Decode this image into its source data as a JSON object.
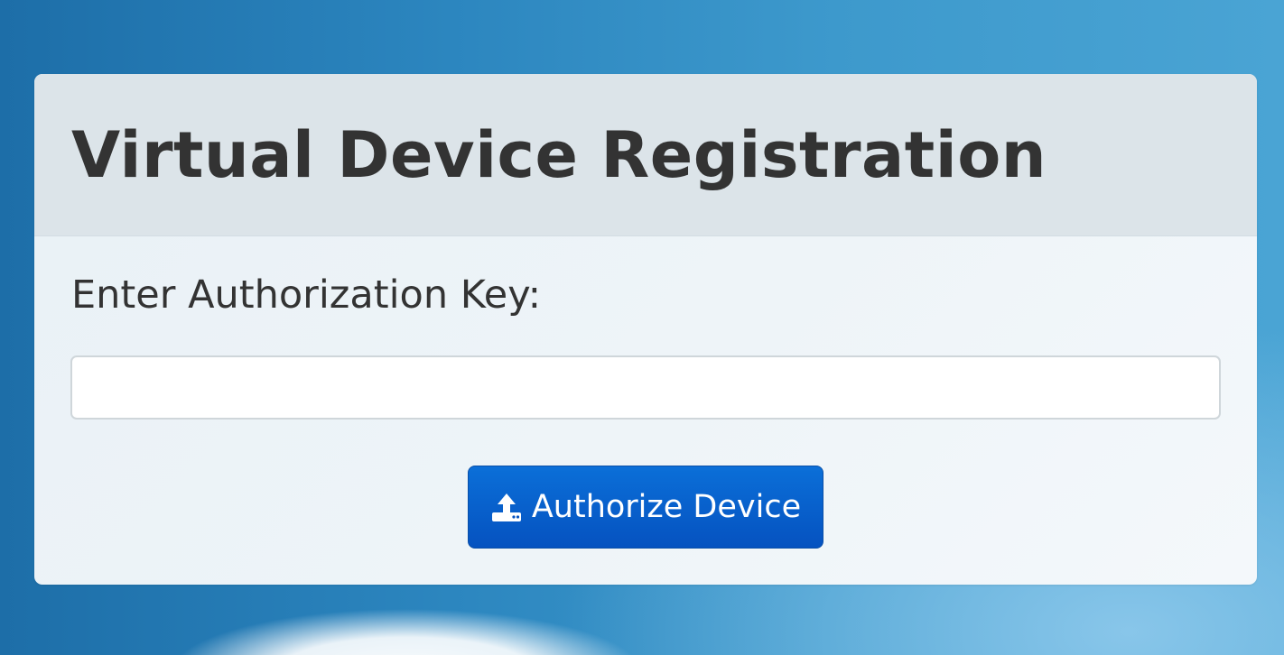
{
  "panel": {
    "title": "Virtual Device Registration"
  },
  "form": {
    "key_label": "Enter Authorization Key:",
    "key_value": "",
    "key_placeholder": ""
  },
  "actions": {
    "authorize_label": "Authorize Device",
    "authorize_icon": "upload-icon",
    "button_color": "#0b63d0"
  }
}
